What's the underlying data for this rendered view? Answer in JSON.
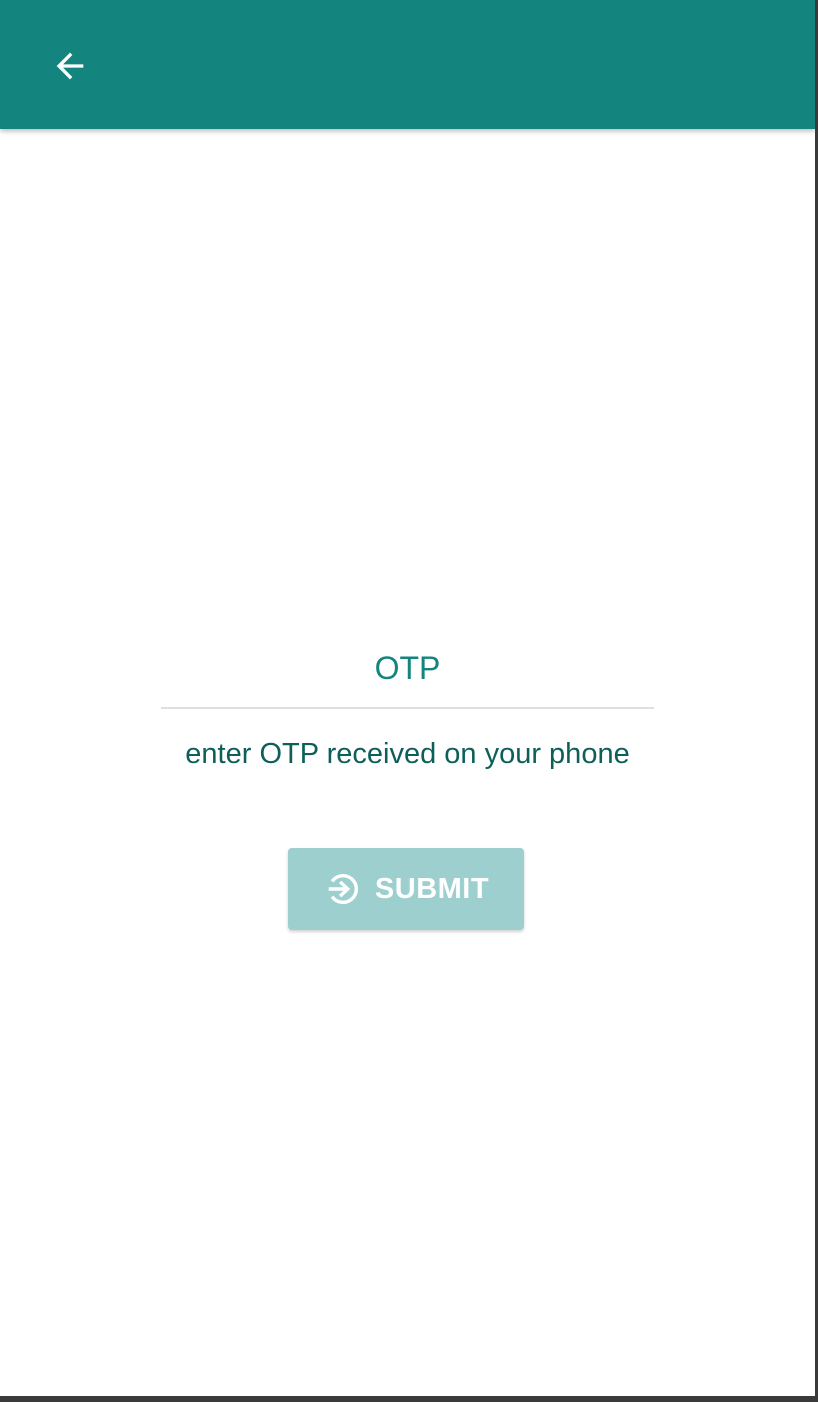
{
  "app_bar": {
    "color": "#13847e",
    "back_icon": "arrow-back-icon"
  },
  "otp_field": {
    "placeholder": "OTP",
    "value": ""
  },
  "helper_text": "enter OTP received on your phone",
  "submit": {
    "label": "SUBMIT",
    "icon": "login-arrow-circle-icon",
    "state": "disabled"
  }
}
